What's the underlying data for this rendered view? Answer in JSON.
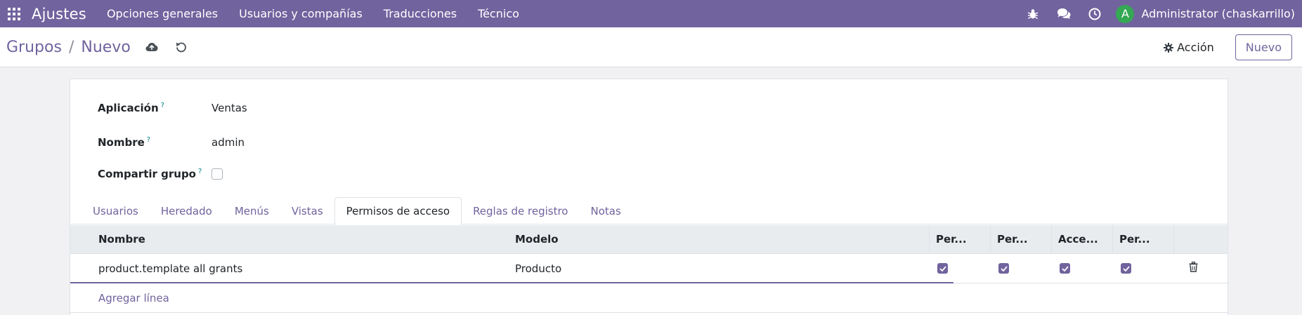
{
  "navbar": {
    "brand": "Ajustes",
    "menu": [
      "Opciones generales",
      "Usuarios y compañías",
      "Traducciones",
      "Técnico"
    ],
    "user_initial": "A",
    "user_name": "Administrator (chaskarrillo)",
    "icons": [
      "apps-grid-icon",
      "bug-icon",
      "chat-icon",
      "clock-icon"
    ]
  },
  "control_panel": {
    "breadcrumb_parent": "Grupos",
    "breadcrumb_separator": "/",
    "breadcrumb_current": "Nuevo",
    "action_label": "Acción",
    "new_label": "Nuevo"
  },
  "form": {
    "application_label": "Aplicación",
    "application_value": "Ventas",
    "name_label": "Nombre",
    "name_value": "admin",
    "share_label": "Compartir grupo",
    "help_mark": "?",
    "share_checked": false
  },
  "tabs": [
    {
      "label": "Usuarios",
      "active": false
    },
    {
      "label": "Heredado",
      "active": false
    },
    {
      "label": "Menús",
      "active": false
    },
    {
      "label": "Vistas",
      "active": false
    },
    {
      "label": "Permisos de acceso",
      "active": true
    },
    {
      "label": "Reglas de registro",
      "active": false
    },
    {
      "label": "Notas",
      "active": false
    }
  ],
  "table": {
    "headers": [
      "Nombre",
      "Modelo",
      "Per...",
      "Per...",
      "Acce...",
      "Per..."
    ],
    "rows": [
      {
        "name": "product.template all grants",
        "model": "Producto",
        "perms": [
          true,
          true,
          true,
          true
        ]
      }
    ],
    "add_line": "Agregar línea"
  },
  "colors": {
    "primary": "#71639e",
    "avatar": "#34a853"
  }
}
